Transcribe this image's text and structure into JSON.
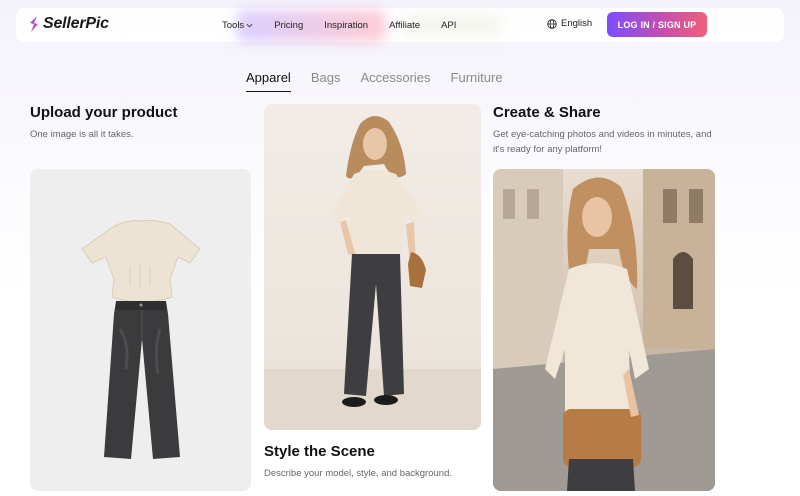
{
  "brand": {
    "name": "SellerPic"
  },
  "nav": {
    "items": [
      {
        "label": "Tools",
        "dropdown": true
      },
      {
        "label": "Pricing"
      },
      {
        "label": "Inspiration"
      },
      {
        "label": "Affiliate"
      },
      {
        "label": "API"
      }
    ],
    "language": "English",
    "cta": "LOG IN / SIGN UP"
  },
  "tabs": [
    {
      "label": "Apparel",
      "active": true
    },
    {
      "label": "Bags"
    },
    {
      "label": "Accessories"
    },
    {
      "label": "Furniture"
    }
  ],
  "columns": {
    "upload": {
      "title": "Upload your product",
      "desc": "One image is all it takes."
    },
    "style": {
      "title": "Style the Scene",
      "desc": "Describe your model, style, and background."
    },
    "share": {
      "title": "Create & Share",
      "desc": "Get eye-catching photos and videos in minutes, and it's ready for any platform!"
    }
  },
  "colors": {
    "accent_start": "#7b4dff",
    "accent_end": "#f0607a",
    "text": "#111111",
    "muted": "#666666"
  }
}
